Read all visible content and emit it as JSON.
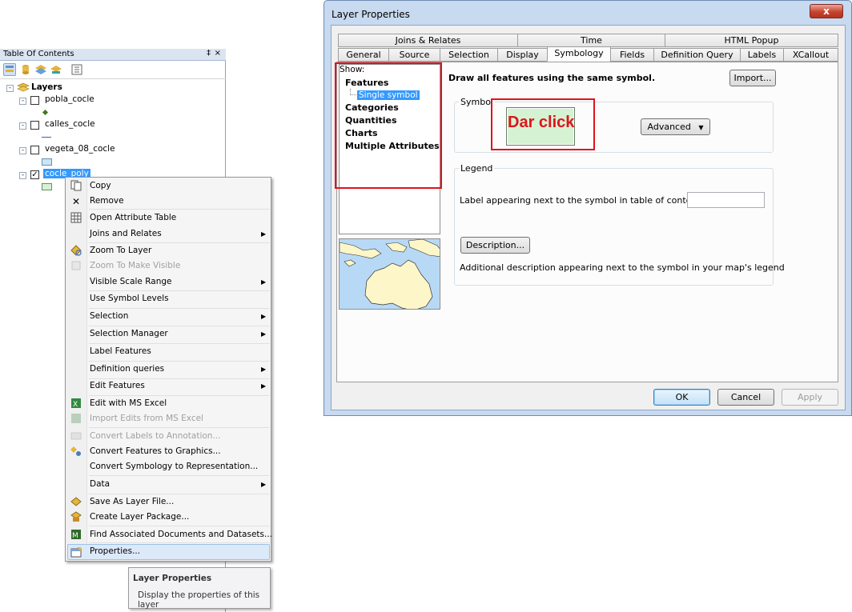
{
  "toc": {
    "title": "Table Of Contents",
    "pin_glyph": "‡",
    "close_glyph": "×",
    "toolbar_icons": [
      "list-by-drawing-order-icon",
      "list-by-source-icon",
      "list-by-visibility-icon",
      "list-by-selection-icon",
      "options-icon"
    ],
    "root_label": "Layers",
    "layers": [
      {
        "name": "pobla_cocle",
        "checked": false,
        "symbol": "point"
      },
      {
        "name": "calles_cocle",
        "checked": false,
        "symbol": "line"
      },
      {
        "name": "vegeta_08_cocle",
        "checked": false,
        "symbol": "polygon-blue"
      },
      {
        "name": "cocle_poly",
        "checked": true,
        "symbol": "polygon-green",
        "selected": true
      }
    ]
  },
  "context_menu": {
    "items": [
      {
        "label": "Copy",
        "icon": "copy-icon",
        "enabled": true
      },
      {
        "label": "Remove",
        "icon": "remove-icon",
        "enabled": true
      },
      {
        "label": "Open Attribute Table",
        "icon": "table-icon",
        "enabled": true
      },
      {
        "label": "Joins and Relates",
        "enabled": true,
        "submenu": true
      },
      {
        "label": "Zoom To Layer",
        "icon": "zoom-to-layer-icon",
        "enabled": true
      },
      {
        "label": "Zoom To Make Visible",
        "icon": "zoom-visible-icon",
        "enabled": false
      },
      {
        "label": "Visible Scale Range",
        "enabled": true,
        "submenu": true
      },
      {
        "label": "Use Symbol Levels",
        "enabled": true
      },
      {
        "label": "Selection",
        "enabled": true,
        "submenu": true
      },
      {
        "label": "Selection Manager",
        "enabled": true,
        "submenu": true
      },
      {
        "label": "Label Features",
        "enabled": true
      },
      {
        "label": "Definition queries",
        "enabled": true,
        "submenu": true
      },
      {
        "label": "Edit Features",
        "enabled": true,
        "submenu": true
      },
      {
        "label": "Edit with MS Excel",
        "icon": "excel-icon",
        "enabled": true
      },
      {
        "label": "Import Edits from MS Excel",
        "icon": "excel-import-icon",
        "enabled": false
      },
      {
        "label": "Convert Labels to Annotation...",
        "icon": "convert-labels-icon",
        "enabled": false
      },
      {
        "label": "Convert Features to Graphics...",
        "icon": "convert-graphics-icon",
        "enabled": true
      },
      {
        "label": "Convert Symbology to Representation...",
        "enabled": true
      },
      {
        "label": "Data",
        "enabled": true,
        "submenu": true
      },
      {
        "label": "Save As Layer File...",
        "icon": "layer-file-icon",
        "enabled": true
      },
      {
        "label": "Create Layer Package...",
        "icon": "layer-package-icon",
        "enabled": true
      },
      {
        "label": "Find Associated Documents and Datasets...",
        "icon": "find-documents-icon",
        "enabled": true
      },
      {
        "label": "Properties...",
        "icon": "properties-icon",
        "enabled": true,
        "highlighted": true
      }
    ]
  },
  "tooltip": {
    "title": "Layer Properties",
    "body": "Display the properties of this layer"
  },
  "dialog": {
    "title": "Layer Properties",
    "close_glyph": "x",
    "tabs_row1": [
      "Joins & Relates",
      "Time",
      "HTML Popup"
    ],
    "tabs_row2": [
      "General",
      "Source",
      "Selection",
      "Display",
      "Symbology",
      "Fields",
      "Definition Query",
      "Labels",
      "XCallout"
    ],
    "active_tab": "Symbology",
    "show_label": "Show:",
    "show_items": [
      "Features",
      "Single symbol",
      "Categories",
      "Quantities",
      "Charts",
      "Multiple Attributes"
    ],
    "selected_show_item": "Single symbol",
    "draw_text": "Draw all features using the same symbol.",
    "import_button": "Import...",
    "symbol_group_label": "Symbol",
    "symbol_fill": "#d5f2d3",
    "annotation_text": "Dar click",
    "annotation_color": "#e0131c",
    "advanced_button": "Advanced",
    "legend_group_label": "Legend",
    "legend_label_text": "Label appearing next to the symbol in table of contents:",
    "legend_label_value": "",
    "description_button": "Description...",
    "description_text": "Additional description appearing next to the symbol in your map's legend",
    "ok_button": "OK",
    "cancel_button": "Cancel",
    "apply_button": "Apply"
  }
}
